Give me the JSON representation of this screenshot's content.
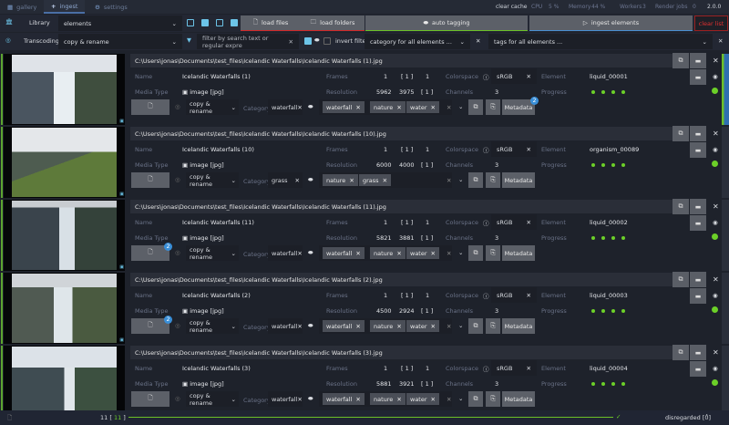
{
  "nav": {
    "tabs": [
      {
        "label": "gallery",
        "icon": "grid-icon"
      },
      {
        "label": "ingest",
        "icon": "plus-icon"
      },
      {
        "label": "settings",
        "icon": "gears-icon"
      }
    ]
  },
  "status": {
    "clear_cache": "clear cache",
    "cpu_label": "CPU",
    "cpu": "5 %",
    "memory_label": "Memory",
    "memory": "44 %",
    "workers_label": "Workers",
    "workers": "3",
    "render_label": "Render jobs",
    "render": "0",
    "version": "2.0.0"
  },
  "toolbar": {
    "library_label": "Library",
    "library_value": "elements",
    "transcoding_label": "Transcoding",
    "transcoding_value": "copy & rename",
    "load_files": "load files",
    "load_folders": "load folders",
    "auto_tagging": "auto tagging",
    "ingest_elements": "ingest elements",
    "clear_list": "clear list",
    "filter_placeholder": "filter by search text or regular expre",
    "invert_filter": "invert filter",
    "category_placeholder": "category for all elements ...",
    "tags_placeholder": "tags for all elements ..."
  },
  "labels": {
    "name": "Name",
    "media_type": "Media Type",
    "frames": "Frames",
    "resolution": "Resolution",
    "colorspace": "Colorspace",
    "channels": "Channels",
    "element": "Element",
    "progress": "Progress",
    "category": "Category",
    "metadata": "Metadata",
    "media_value": "image [jpg]"
  },
  "colors": {
    "accent_green": "#6cd028",
    "accent_blue": "#4a8fd0",
    "danger": "#e03030"
  },
  "rows": [
    {
      "path": "C:\\Users\\jonas\\Documents\\test_files\\Icelandic Waterfalls\\Icelandic Waterfalls (1).jpg",
      "name": "Icelandic Waterfalls (1)",
      "frames": [
        "1",
        "[ 1 ]",
        "1"
      ],
      "resolution": [
        "5962",
        "3975",
        "[ 1 ]"
      ],
      "colorspace": "sRGB",
      "channels": "3",
      "element": "liquid_00001",
      "transcoding": "copy & rename",
      "category": "waterfall",
      "tags": [
        "waterfall",
        "nature",
        "water"
      ],
      "metadata_badge": "2",
      "file_badge": ""
    },
    {
      "path": "C:\\Users\\jonas\\Documents\\test_files\\Icelandic Waterfalls\\Icelandic Waterfalls (10).jpg",
      "name": "Icelandic Waterfalls (10)",
      "frames": [
        "1",
        "[ 1 ]",
        "1"
      ],
      "resolution": [
        "6000",
        "4000",
        "[ 1 ]"
      ],
      "colorspace": "sRGB",
      "channels": "3",
      "element": "organism_00089",
      "transcoding": "copy & rename",
      "category": "grass",
      "tags": [
        "nature",
        "grass"
      ],
      "metadata_badge": "",
      "file_badge": ""
    },
    {
      "path": "C:\\Users\\jonas\\Documents\\test_files\\Icelandic Waterfalls\\Icelandic Waterfalls (11).jpg",
      "name": "Icelandic Waterfalls (11)",
      "frames": [
        "1",
        "[ 1 ]",
        "1"
      ],
      "resolution": [
        "5821",
        "3881",
        "[ 1 ]"
      ],
      "colorspace": "sRGB",
      "channels": "3",
      "element": "liquid_00002",
      "transcoding": "copy & rename",
      "category": "waterfall",
      "tags": [
        "waterfall",
        "nature",
        "water"
      ],
      "metadata_badge": "",
      "file_badge": "2"
    },
    {
      "path": "C:\\Users\\jonas\\Documents\\test_files\\Icelandic Waterfalls\\Icelandic Waterfalls (2).jpg",
      "name": "Icelandic Waterfalls (2)",
      "frames": [
        "1",
        "[ 1 ]",
        "1"
      ],
      "resolution": [
        "4500",
        "2924",
        "[ 1 ]"
      ],
      "colorspace": "sRGB",
      "channels": "3",
      "element": "liquid_00003",
      "transcoding": "copy & rename",
      "category": "waterfall",
      "tags": [
        "waterfall",
        "nature",
        "water"
      ],
      "metadata_badge": "",
      "file_badge": "2"
    },
    {
      "path": "C:\\Users\\jonas\\Documents\\test_files\\Icelandic Waterfalls\\Icelandic Waterfalls (3).jpg",
      "name": "Icelandic Waterfalls (3)",
      "frames": [
        "1",
        "[ 1 ]",
        "1"
      ],
      "resolution": [
        "5881",
        "3921",
        "[ 1 ]"
      ],
      "colorspace": "sRGB",
      "channels": "3",
      "element": "liquid_00004",
      "transcoding": "copy & rename",
      "category": "waterfall",
      "tags": [
        "waterfall",
        "nature",
        "water"
      ],
      "metadata_badge": "",
      "file_badge": ""
    }
  ],
  "footer": {
    "count": "11",
    "count_bracket": "11",
    "disregarded": "disregarded [0]"
  }
}
